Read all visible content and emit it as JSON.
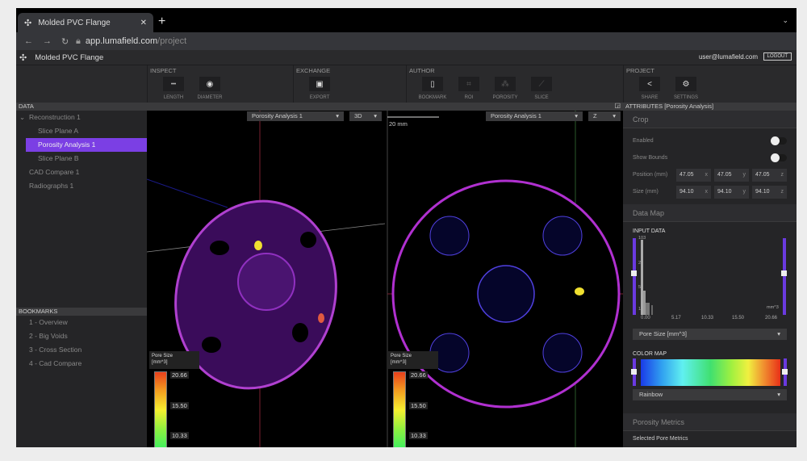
{
  "browser": {
    "tab_title": "Molded PVC Flange",
    "url_host": "app.lumafield.com",
    "url_path": "/project"
  },
  "app": {
    "title": "Molded PVC Flange",
    "user": "user@lumafield.com",
    "logout": "LOGOUT"
  },
  "toolbar": {
    "inspect": {
      "label": "INSPECT",
      "tools": [
        {
          "label": "LENGTH",
          "icon": "length-icon"
        },
        {
          "label": "DIAMETER",
          "icon": "diameter-icon"
        }
      ]
    },
    "exchange": {
      "label": "EXCHANGE",
      "tools": [
        {
          "label": "EXPORT",
          "icon": "export-icon"
        }
      ]
    },
    "author": {
      "label": "AUTHOR",
      "tools": [
        {
          "label": "BOOKMARK",
          "icon": "bookmark-icon"
        },
        {
          "label": "ROI",
          "icon": "crop-icon"
        },
        {
          "label": "POROSITY",
          "icon": "porosity-icon"
        },
        {
          "label": "SLICE",
          "icon": "slice-icon"
        }
      ]
    },
    "project": {
      "label": "PROJECT",
      "tools": [
        {
          "label": "SHARE",
          "icon": "share-icon"
        },
        {
          "label": "SETTINGS",
          "icon": "gear-icon"
        }
      ]
    }
  },
  "data_panel": {
    "header": "DATA",
    "items": [
      "Reconstruction 1",
      "Slice Plane A",
      "Porosity Analysis 1",
      "Slice Plane B",
      "CAD Compare 1",
      "Radiographs 1"
    ],
    "selected": "Porosity Analysis 1"
  },
  "bookmarks": {
    "header": "BOOKMARKS",
    "items": [
      "1 - Overview",
      "2 - Big Voids",
      "3 - Cross Section",
      "4 - Cad Compare"
    ]
  },
  "viewport": {
    "left": {
      "dataset": "Porosity Analysis 1",
      "mode": "3D"
    },
    "right": {
      "dataset": "Porosity Analysis 1",
      "axis": "Z"
    },
    "scale": "20 mm",
    "legend": {
      "title": "Pore Size",
      "unit": "[mm^3]",
      "ticks": [
        "20.66",
        "15.50",
        "10.33"
      ]
    }
  },
  "attributes": {
    "header": "ATTRIBUTES [Porosity Analysis]",
    "crop": {
      "title": "Crop",
      "enabled_label": "Enabled",
      "enabled": false,
      "bounds_label": "Show Bounds",
      "bounds": false,
      "position_label": "Position (mm)",
      "position": [
        "47.05",
        "47.05",
        "47.05"
      ],
      "size_label": "Size (mm)",
      "size": [
        "94.10",
        "94.10",
        "94.10"
      ],
      "axes": [
        "x",
        "y",
        "z"
      ]
    },
    "data_map": {
      "title": "Data Map",
      "input_label": "INPUT DATA",
      "y_ticks": [
        "103",
        "22",
        "5",
        "1"
      ],
      "x_ticks": [
        "0.00",
        "5.17",
        "10.33",
        "15.50",
        "20.66"
      ],
      "unit": "mm^3",
      "property": "Pore Size [mm^3]",
      "colormap_label": "COLOR MAP",
      "colormap": "Rainbow"
    },
    "metrics": {
      "title": "Porosity Metrics",
      "selected": "Selected Pore Metrics"
    }
  },
  "colors": {
    "accent": "#7b3fe4",
    "background": "#252527"
  }
}
